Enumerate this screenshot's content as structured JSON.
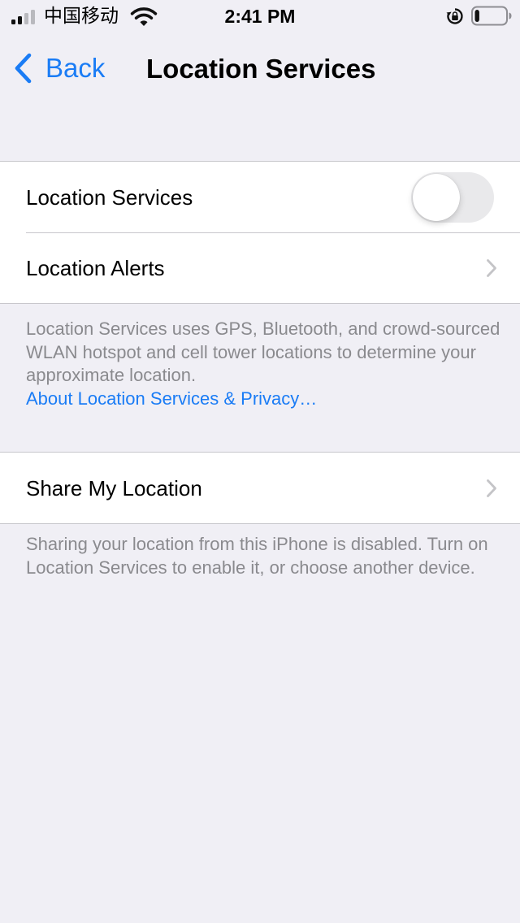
{
  "status_bar": {
    "carrier": "中国移动",
    "time": "2:41 PM",
    "icons": [
      "signal-icon",
      "wifi-icon",
      "orientation-lock-icon",
      "battery-icon"
    ],
    "battery_level": 0.15
  },
  "nav": {
    "back_label": "Back",
    "title": "Location Services"
  },
  "group1": {
    "location_services_label": "Location Services",
    "location_services_on": false,
    "location_alerts_label": "Location Alerts"
  },
  "footer1": {
    "text": "Location Services uses GPS, Bluetooth, and crowd-sourced WLAN hotspot and cell tower locations to determine your approximate location.",
    "link": "About Location Services & Privacy…"
  },
  "group2": {
    "share_my_location_label": "Share My Location"
  },
  "footer2": {
    "text": "Sharing your location from this iPhone is disabled. Turn on Location Services to enable it, or choose another device."
  },
  "colors": {
    "accent": "#1a7cf5",
    "background": "#f0eff5",
    "separator": "#c8c7cc",
    "secondary_text": "#8a8a8e",
    "toggle_off": "#e9e9eb"
  }
}
